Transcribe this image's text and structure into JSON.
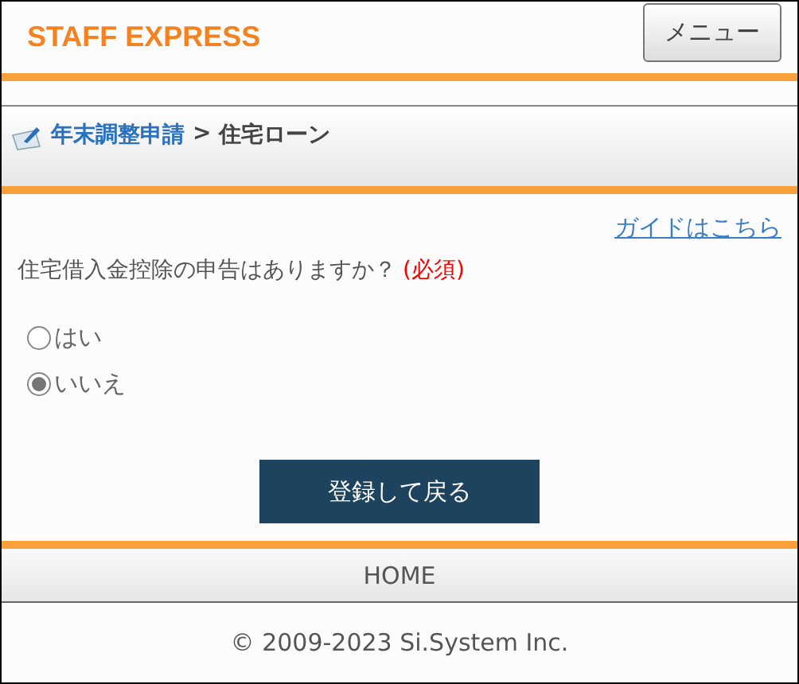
{
  "header": {
    "logo": "STAFF EXPRESS",
    "menu_button": "メニュー"
  },
  "breadcrumb": {
    "parent": "年末調整申請",
    "separator": ">",
    "current": "住宅ローン"
  },
  "guide_link": "ガイドはこちら",
  "question": {
    "text": "住宅借入金控除の申告はありますか？",
    "required": "(必須)"
  },
  "options": [
    {
      "label": "はい",
      "selected": false
    },
    {
      "label": "いいえ",
      "selected": true
    }
  ],
  "submit_button": "登録して戻る",
  "footer": {
    "home_link": "HOME",
    "copyright": "© 2009-2023 Si.System Inc."
  }
}
